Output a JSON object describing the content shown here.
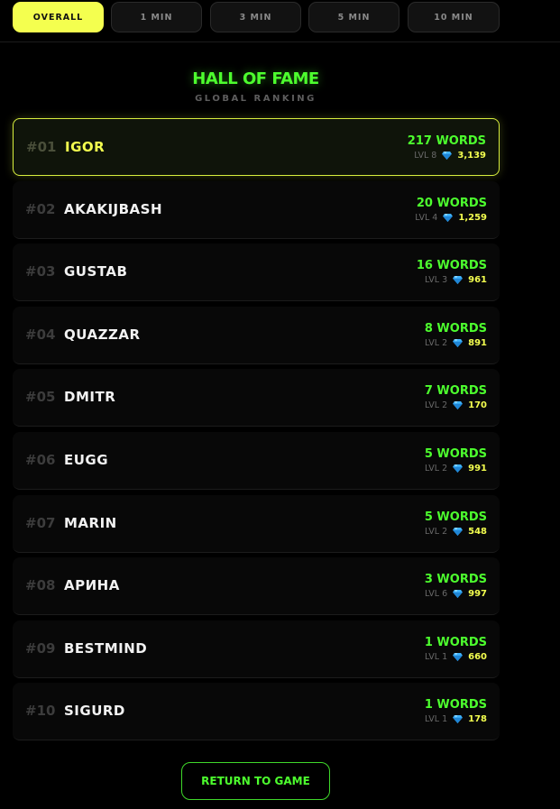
{
  "tabs": [
    {
      "label": "OVERALL",
      "active": true
    },
    {
      "label": "1 MIN",
      "active": false
    },
    {
      "label": "3 MIN",
      "active": false
    },
    {
      "label": "5 MIN",
      "active": false
    },
    {
      "label": "10 MIN",
      "active": false
    }
  ],
  "header": {
    "title": "HALL OF FAME",
    "subtitle": "GLOBAL RANKING"
  },
  "leaderboard": [
    {
      "rank": "#01",
      "name": "IGOR",
      "words": "217 WORDS",
      "level": "LVL 8",
      "score": "3,139"
    },
    {
      "rank": "#02",
      "name": "AKAKIJBASH",
      "words": "20 WORDS",
      "level": "LVL 4",
      "score": "1,259"
    },
    {
      "rank": "#03",
      "name": "GUSTAB",
      "words": "16 WORDS",
      "level": "LVL 3",
      "score": "961"
    },
    {
      "rank": "#04",
      "name": "QUAZZAR",
      "words": "8 WORDS",
      "level": "LVL 2",
      "score": "891"
    },
    {
      "rank": "#05",
      "name": "DMITR",
      "words": "7 WORDS",
      "level": "LVL 2",
      "score": "170"
    },
    {
      "rank": "#06",
      "name": "EUGG",
      "words": "5 WORDS",
      "level": "LVL 2",
      "score": "991"
    },
    {
      "rank": "#07",
      "name": "MARIN",
      "words": "5 WORDS",
      "level": "LVL 2",
      "score": "548"
    },
    {
      "rank": "#08",
      "name": "АРИНА",
      "words": "3 WORDS",
      "level": "LVL 6",
      "score": "997"
    },
    {
      "rank": "#09",
      "name": "BESTMIND",
      "words": "1 WORDS",
      "level": "LVL 1",
      "score": "660"
    },
    {
      "rank": "#10",
      "name": "SIGURD",
      "words": "1 WORDS",
      "level": "LVL 1",
      "score": "178"
    }
  ],
  "score_icon": "diamond-gem-icon",
  "colors": {
    "accent_yellow": "#f4ff4f",
    "accent_green": "#4dff2e",
    "gem_blue": "#3fb3ff"
  },
  "footer": {
    "return_label": "RETURN TO GAME"
  }
}
